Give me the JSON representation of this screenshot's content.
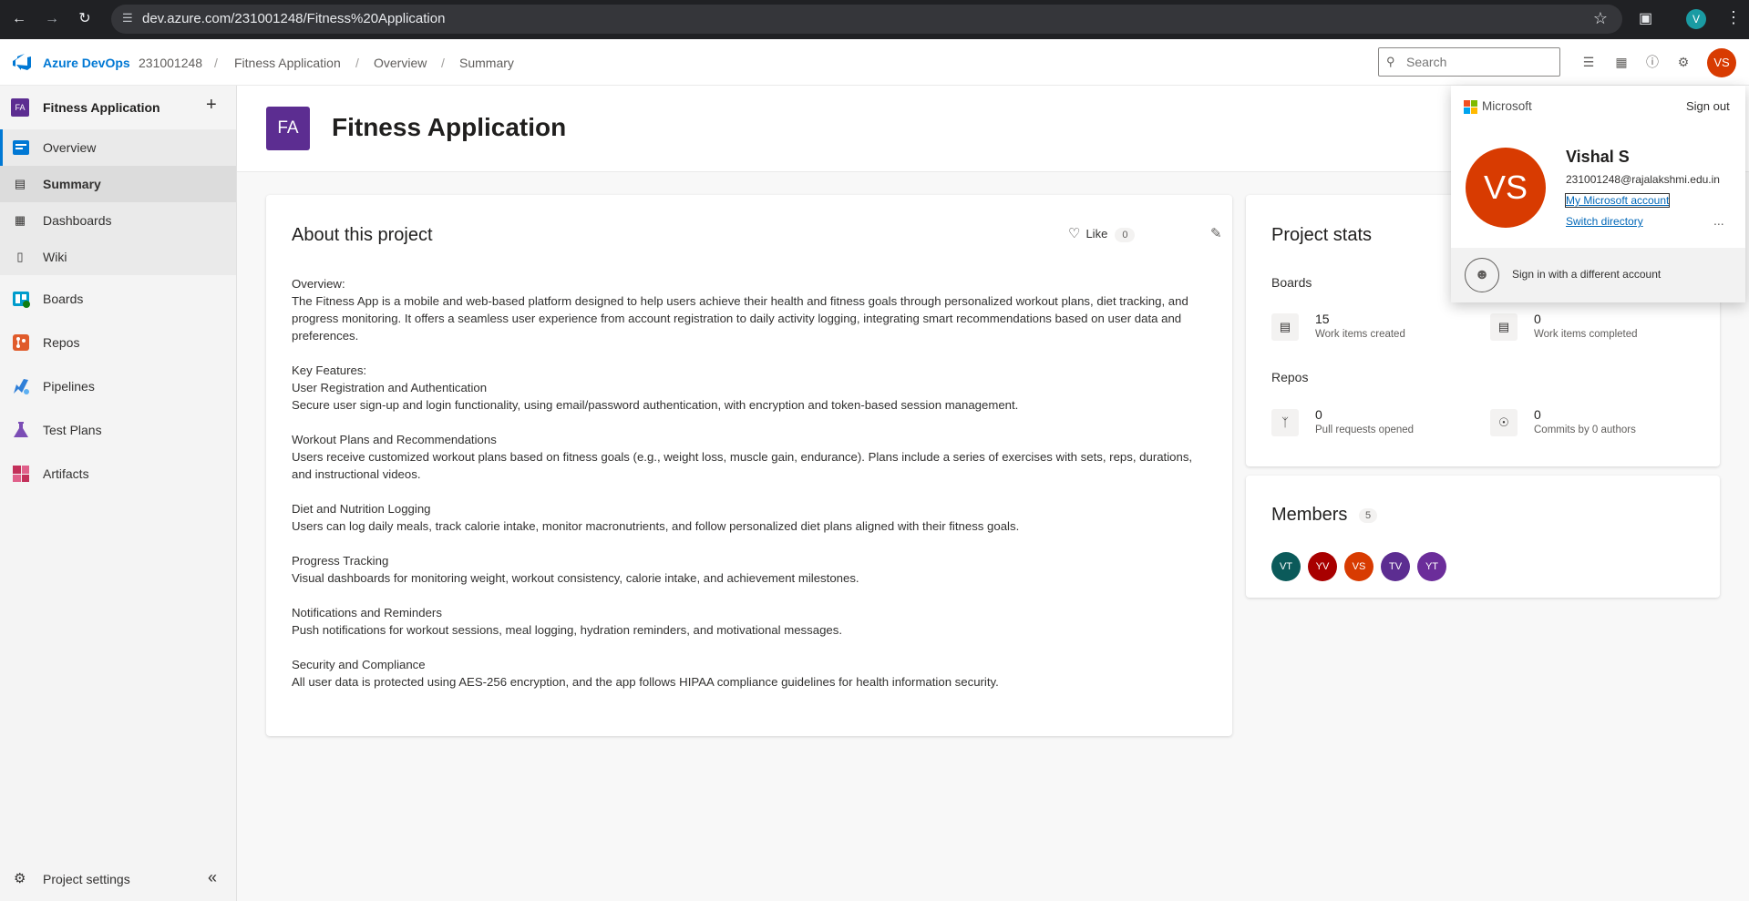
{
  "browser": {
    "url": "dev.azure.com/231001248/Fitness%20Application",
    "profile_initial": "V"
  },
  "header": {
    "brand": "Azure DevOps",
    "breadcrumbs": [
      "231001248",
      "Fitness Application",
      "Overview",
      "Summary"
    ],
    "search_placeholder": "Search",
    "avatar_initials": "VS"
  },
  "sidebar": {
    "project_initials": "FA",
    "project_name": "Fitness Application",
    "items": [
      {
        "label": "Overview",
        "color": "#0078d4"
      },
      {
        "label": "Summary"
      },
      {
        "label": "Dashboards"
      },
      {
        "label": "Wiki"
      },
      {
        "label": "Boards",
        "color": "#009ccc"
      },
      {
        "label": "Repos",
        "color": "#e05b2b"
      },
      {
        "label": "Pipelines",
        "color": "#2f7fd8"
      },
      {
        "label": "Test Plans",
        "color": "#7b4db5"
      },
      {
        "label": "Artifacts",
        "color": "#c3305a"
      }
    ],
    "settings_label": "Project settings"
  },
  "page": {
    "initials": "FA",
    "title": "Fitness Application"
  },
  "about": {
    "title": "About this project",
    "like_label": "Like",
    "like_count": "0",
    "paragraphs": [
      [
        "Overview:",
        "The Fitness App is a mobile and web-based platform designed to help users achieve their health and fitness goals through personalized workout plans, diet tracking, and progress monitoring. It offers a seamless user experience from account registration to daily activity logging, integrating smart recommendations based on user data and preferences."
      ],
      [
        "Key Features:",
        "User Registration and Authentication",
        "Secure user sign-up and login functionality, using email/password authentication, with encryption and token-based session management."
      ],
      [
        "Workout Plans and Recommendations",
        "Users receive customized workout plans based on fitness goals (e.g., weight loss, muscle gain, endurance). Plans include a series of exercises with sets, reps, durations, and instructional videos."
      ],
      [
        "Diet and Nutrition Logging",
        "Users can log daily meals, track calorie intake, monitor macronutrients, and follow personalized diet plans aligned with their fitness goals."
      ],
      [
        "Progress Tracking",
        "Visual dashboards for monitoring weight, workout consistency, calorie intake, and achievement milestones."
      ],
      [
        "Notifications and Reminders",
        "Push notifications for workout sessions, meal logging, hydration reminders, and motivational messages."
      ],
      [
        "Security and Compliance",
        "All user data is protected using AES-256 encryption, and the app follows HIPAA compliance guidelines for health information security."
      ]
    ]
  },
  "stats": {
    "title": "Project stats",
    "boards_label": "Boards",
    "repos_label": "Repos",
    "work_items_created": "15",
    "work_items_created_label": "Work items created",
    "work_items_completed": "0",
    "work_items_completed_label": "Work items completed",
    "pull_requests": "0",
    "pull_requests_label": "Pull requests opened",
    "commits": "0",
    "commits_label": "Commits by 0 authors"
  },
  "members": {
    "title": "Members",
    "count": "5",
    "list": [
      {
        "initials": "VT",
        "color": "#0b5a5a"
      },
      {
        "initials": "YV",
        "color": "#a80000"
      },
      {
        "initials": "VS",
        "color": "#d83b01"
      },
      {
        "initials": "TV",
        "color": "#5c2d91"
      },
      {
        "initials": "YT",
        "color": "#6b2d9a"
      }
    ]
  },
  "account": {
    "provider": "Microsoft",
    "sign_out": "Sign out",
    "initials": "VS",
    "name": "Vishal S",
    "email": "231001248@rajalakshmi.edu.in",
    "my_account": "My Microsoft account",
    "switch_directory": "Switch directory",
    "more": "...",
    "different_account": "Sign in with a different account"
  }
}
